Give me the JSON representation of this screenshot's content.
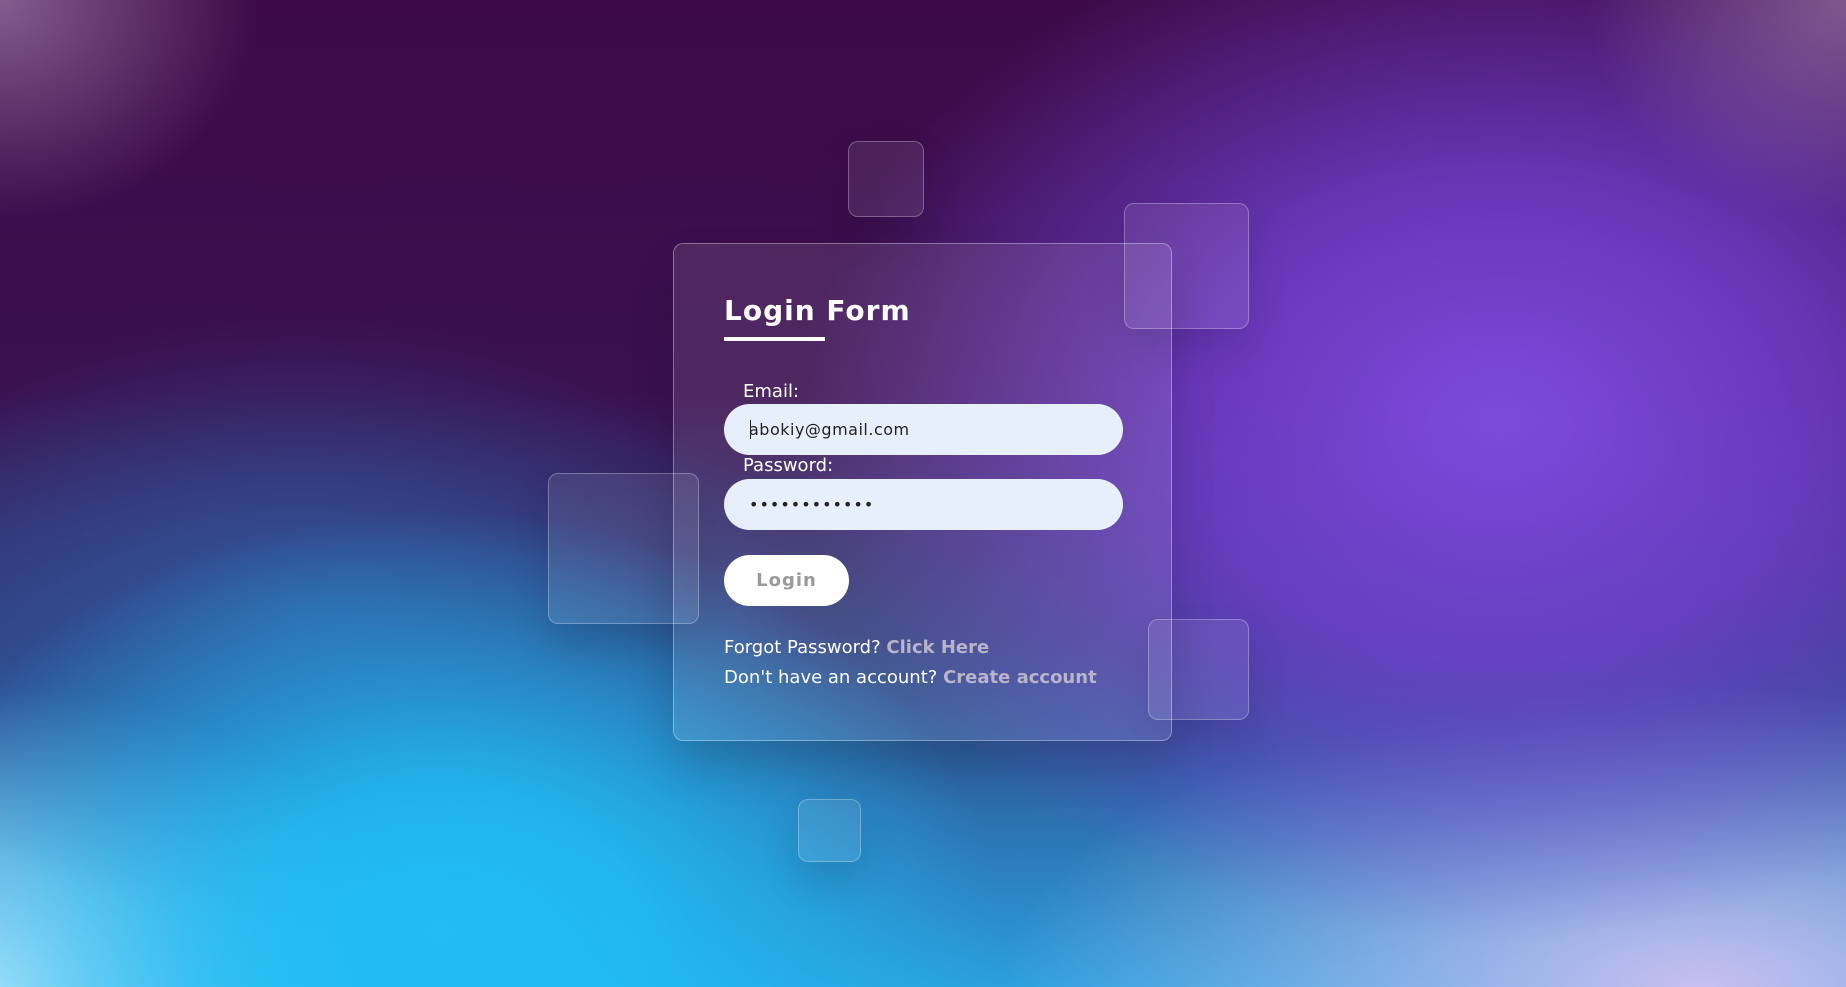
{
  "login_form": {
    "title": "Login Form",
    "email": {
      "label": "Email:",
      "value": "abokiy@gmail.com"
    },
    "password": {
      "label": "Password:",
      "value": "••••••••••••"
    },
    "login_button": "Login",
    "forgot": {
      "text": "Forgot Password?",
      "link": "Click Here"
    },
    "signup": {
      "text": "Don't have an account?",
      "link": "Create account"
    }
  },
  "colors": {
    "accent_cyan": "#20bef5",
    "accent_purple": "#7d4bdc",
    "background_dark": "#3b0a48",
    "input_bg": "#e8effc"
  }
}
